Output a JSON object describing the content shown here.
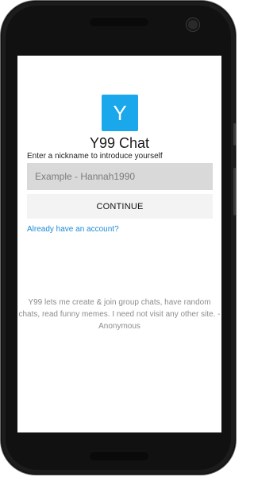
{
  "app": {
    "logo_letter": "Y",
    "title": "Y99 Chat",
    "accent_color": "#1aa7ec"
  },
  "form": {
    "intro_label": "Enter a nickname to introduce yourself",
    "nickname_placeholder": "Example - Hannah1990",
    "nickname_value": "",
    "continue_label": "CONTINUE",
    "account_link_text": "Already have an account?"
  },
  "testimonial": {
    "text": "Y99 lets me create & join group chats, have random chats, read funny memes. I need not visit any other site. - Anonymous"
  },
  "icons": {
    "front_camera": "front-camera-icon",
    "earpiece": "earpiece-speaker-icon",
    "bottom_speaker": "bottom-speaker-icon"
  }
}
